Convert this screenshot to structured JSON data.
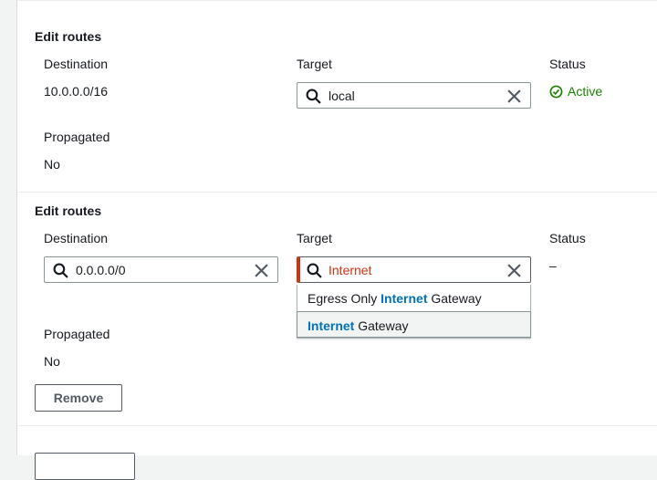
{
  "route1": {
    "title": "Edit routes",
    "destination_label": "Destination",
    "destination_value": "10.0.0.0/16",
    "target_label": "Target",
    "target_value": "local",
    "status_label": "Status",
    "status_value": "Active",
    "propagated_label": "Propagated",
    "propagated_value": "No"
  },
  "route2": {
    "title": "Edit routes",
    "destination_label": "Destination",
    "destination_value": "0.0.0.0/0",
    "target_label": "Target",
    "target_value": "Internet",
    "status_label": "Status",
    "status_value": "–",
    "propagated_label": "Propagated",
    "propagated_value": "No",
    "remove_label": "Remove",
    "dropdown": {
      "options": [
        {
          "before": "Egress Only ",
          "match": "Internet",
          "after": " Gateway"
        },
        {
          "before": "",
          "match": "Internet",
          "after": " Gateway"
        }
      ]
    }
  },
  "colors": {
    "success": "#1d8102",
    "error": "#d13212",
    "match": "#0073bb",
    "highlight_bg": "#f2f3f3"
  },
  "icons": [
    "search-icon",
    "clear-icon",
    "status-positive-icon"
  ]
}
